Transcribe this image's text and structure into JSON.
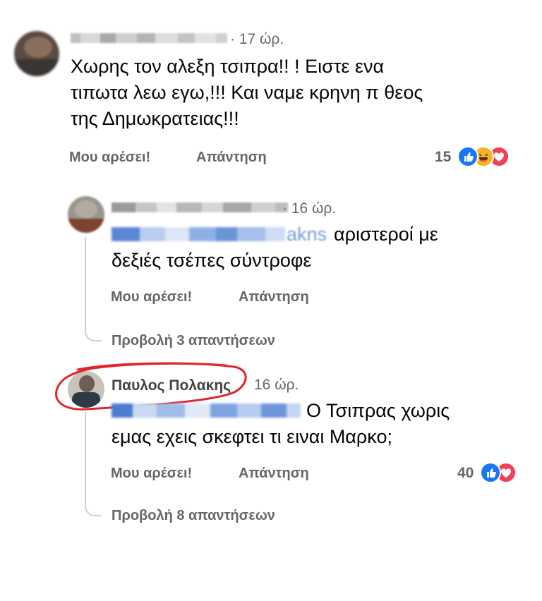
{
  "comments": [
    {
      "time": "· 17 ώρ.",
      "text_lines": [
        "Χωρης τον αλεξη τσιπρα!! ! Ειστε ενα",
        "τιπωτα λεω εγω,!!! Και ναμε κρηνη π θεος",
        "της Δημωκρατειας!!!"
      ],
      "like_label": "Μου αρέσει!",
      "reply_label": "Απάντηση",
      "reaction_count": "15"
    },
    {
      "time": "· 16 ώρ.",
      "mention_trailing": "akns",
      "text_line1": "αριστεροί με",
      "text_line2": "δεξιές τσέπες σύντροφε",
      "like_label": "Μου αρέσει!",
      "reply_label": "Απάντηση",
      "view_replies": "Προβολή 3 απαντήσεων"
    },
    {
      "author": "Παυλος Πολακης",
      "time": "16 ώρ.",
      "text_line1": "Ο Τσιπρας χωρις",
      "text_line2": "εμας εχεις σκεφτει τι ειναι Μαρκο;",
      "like_label": "Μου αρέσει!",
      "reply_label": "Απάντηση",
      "reaction_count": "40",
      "view_replies": "Προβολή 8 απαντήσεων"
    }
  ],
  "colors": {
    "like_blue": "#1877f2",
    "love_red": "#f33e58",
    "haha_yellow": "#f7b125",
    "mention_blue": "#2d6fd1",
    "annotation_red": "#e0262b",
    "meta_gray": "#65676b"
  },
  "icons": [
    "like-reaction-icon",
    "haha-reaction-icon",
    "love-reaction-icon"
  ]
}
